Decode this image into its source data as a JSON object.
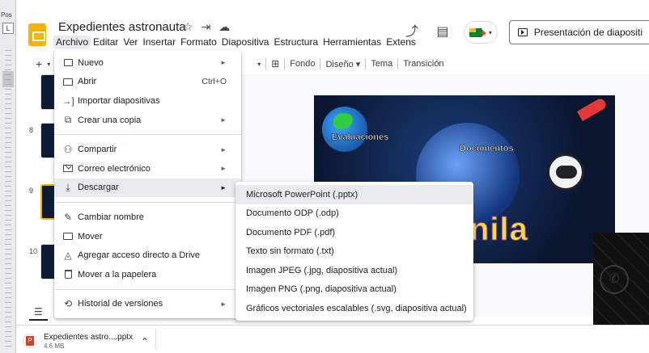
{
  "ruler": {
    "pos_label": "Pos",
    "l_label": "L"
  },
  "doc": {
    "title": "Expedientes astronauta"
  },
  "title_icons": {
    "star": "☆",
    "move": "⇥",
    "cloud": "☁"
  },
  "menubar": [
    "Archivo",
    "Editar",
    "Ver",
    "Insertar",
    "Formato",
    "Diapositiva",
    "Estructura",
    "Herramientas",
    "Extens"
  ],
  "header_right": {
    "trend_icon": "⤴",
    "comment_icon": "▤",
    "present_label": "Presentación de diapositi"
  },
  "toolbar": {
    "plus": "+",
    "background": "Fondo",
    "design": "Diseño",
    "theme": "Tema",
    "transition": "Transición"
  },
  "filmstrip": {
    "numbers": [
      "8",
      "9",
      "10"
    ]
  },
  "slide": {
    "label_left": "Evaluaciones",
    "label_right": "Documentos",
    "word": "nila"
  },
  "archivo_menu": {
    "items": [
      {
        "label": "Nuevo",
        "icon": "new-presentation-icon",
        "submenu": true
      },
      {
        "label": "Abrir",
        "icon": "open-folder-icon",
        "shortcut": "Ctrl+O"
      },
      {
        "label": "Importar diapositivas",
        "icon": "import-icon"
      },
      {
        "label": "Crear una copia",
        "icon": "copy-icon",
        "submenu": true
      },
      {
        "label": "Compartir",
        "icon": "share-icon",
        "submenu": true
      },
      {
        "label": "Correo electrónico",
        "icon": "mail-icon",
        "submenu": true
      },
      {
        "label": "Descargar",
        "icon": "download-icon",
        "submenu": true
      },
      {
        "label": "Cambiar nombre",
        "icon": "rename-icon"
      },
      {
        "label": "Mover",
        "icon": "move-icon"
      },
      {
        "label": "Agregar acceso directo a Drive",
        "icon": "drive-shortcut-icon"
      },
      {
        "label": "Mover a la papelera",
        "icon": "trash-icon"
      },
      {
        "label": "Historial de versiones",
        "icon": "history-icon",
        "submenu": true
      }
    ],
    "hovered": "Descargar"
  },
  "download_submenu": {
    "items": [
      "Microsoft PowerPoint (.pptx)",
      "Documento ODP (.odp)",
      "Documento PDF (.pdf)",
      "Texto sin formato (.txt)",
      "Imagen JPEG (.jpg, diapositiva actual)",
      "Imagen PNG (.png, diapositiva actual)",
      "Gráficos vectoriales escalables (.svg, diapositiva actual)"
    ],
    "hovered": "Microsoft PowerPoint (.pptx)"
  },
  "download_bar": {
    "file_name": "Expedientes astro....pptx",
    "file_size": "4.6 MB"
  },
  "colors": {
    "brand": "#f4b400",
    "menu_hover": "#e8eaed",
    "slide_bg": "#0a1630"
  }
}
